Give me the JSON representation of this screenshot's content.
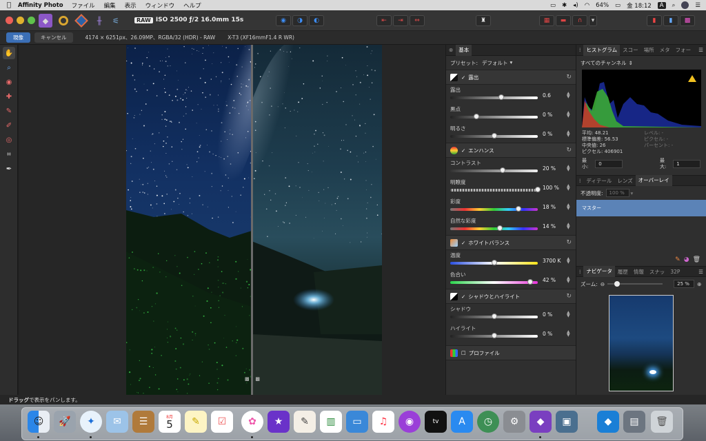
{
  "menubar": {
    "app_name": "Affinity Photo",
    "items": [
      "ファイル",
      "編集",
      "表示",
      "ウィンドウ",
      "ヘルプ"
    ],
    "battery": "64%",
    "clock": "金 18:12",
    "input_indicator": "A"
  },
  "toolbar": {
    "raw_badge": "RAW",
    "camera_settings": "ISO 2500 ƒ/2 16.0mm 15s"
  },
  "contextbar": {
    "develop_label": "現像",
    "cancel_label": "キャンセル",
    "image_info": "4174 × 6251px、26.09MP、RGBA/32 (HDR) - RAW",
    "camera_info": "X-T3 (XF16mmF1.4 R WR)"
  },
  "basic_panel": {
    "tab": "基本",
    "preset_label": "プリセット:",
    "preset_value": "デフォルト",
    "exposure": {
      "title": "露出",
      "sliders": [
        {
          "label": "露出",
          "value": "0.6",
          "pos": 0.58
        },
        {
          "label": "黒点",
          "value": "0 %",
          "pos": 0.3
        },
        {
          "label": "明るさ",
          "value": "0 %",
          "pos": 0.5
        }
      ]
    },
    "enhance": {
      "title": "エンハンス",
      "sliders": [
        {
          "label": "コントラスト",
          "value": "20 %",
          "pos": 0.6
        },
        {
          "label": "明瞭度",
          "value": "100 %",
          "pos": 1.0
        },
        {
          "label": "彩度",
          "value": "18 %",
          "pos": 0.78
        },
        {
          "label": "自然な彩度",
          "value": "14 %",
          "pos": 0.57
        }
      ]
    },
    "white_balance": {
      "title": "ホワイトバランス",
      "sliders": [
        {
          "label": "温度",
          "value": "3700 K",
          "pos": 0.5
        },
        {
          "label": "色合い",
          "value": "42 %",
          "pos": 0.91
        }
      ]
    },
    "shadows": {
      "title": "シャドウとハイライト",
      "sliders": [
        {
          "label": "シャドウ",
          "value": "0 %",
          "pos": 0.5
        },
        {
          "label": "ハイライト",
          "value": "0 %",
          "pos": 0.5
        }
      ]
    },
    "profile": {
      "title": "プロファイル"
    }
  },
  "histogram_panel": {
    "tabs": [
      "ヒストグラム",
      "スコー",
      "場所",
      "メタ",
      "フォー"
    ],
    "channel": "すべてのチャンネル",
    "stats": [
      {
        "label": "平均:",
        "value": "48.21"
      },
      {
        "label": "標準偏差:",
        "value": "56.53"
      },
      {
        "label": "中央値:",
        "value": "26"
      },
      {
        "label": "ピクセル:",
        "value": "406901"
      }
    ],
    "stats_right": [
      "レベル: -",
      "ピクセル: -",
      "パーセント: -"
    ],
    "min_label": "最小:",
    "min_value": "0",
    "max_label": "最大:",
    "max_value": "1"
  },
  "overlay_panel": {
    "tabs": [
      "ディテール",
      "レンズ",
      "オーバーレイ"
    ],
    "opacity_label": "不透明度:",
    "opacity_value": "100 %",
    "master_label": "マスター"
  },
  "navigator_panel": {
    "tabs": [
      "ナビゲータ",
      "履歴",
      "情報",
      "スナッ",
      "32P"
    ],
    "zoom_label": "ズーム:",
    "zoom_value": "25 %"
  },
  "statusbar": {
    "strong": "ドラッグ",
    "text": "で表示をパンします。"
  },
  "dock": {
    "calendar_month": "8月",
    "calendar_day": "5"
  }
}
